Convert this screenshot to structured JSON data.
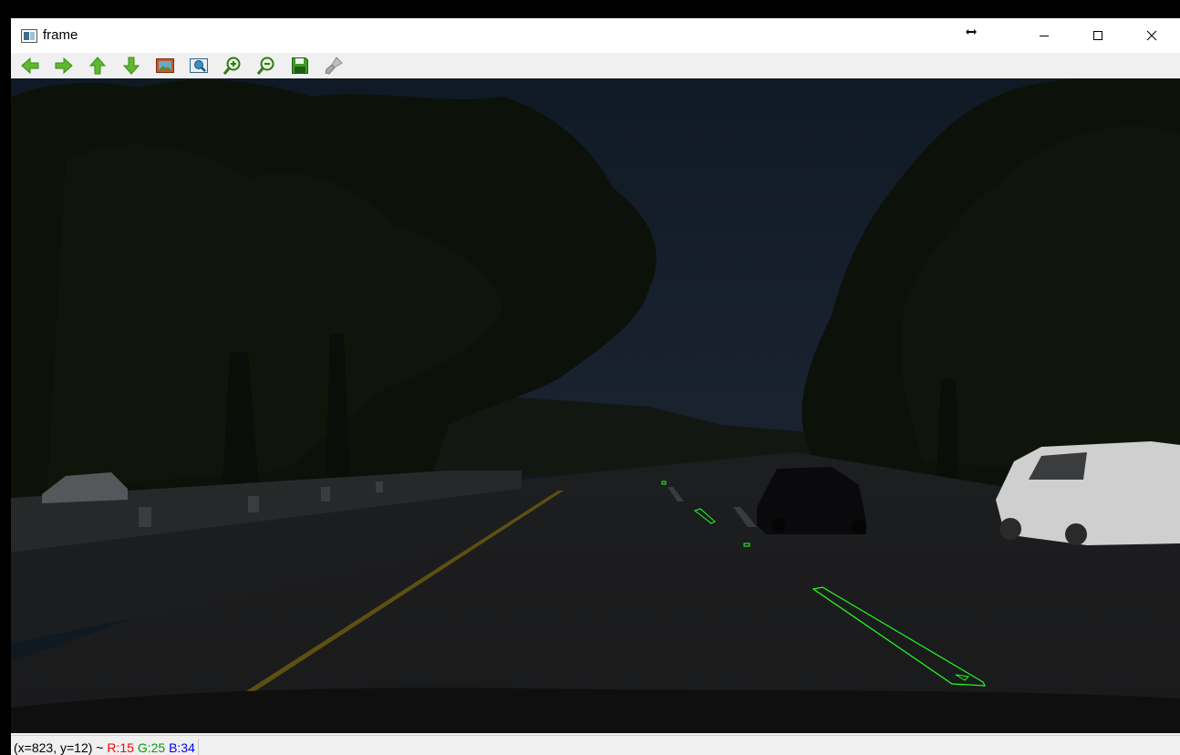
{
  "window": {
    "title": "frame",
    "controls": [
      "minimize",
      "maximize",
      "close"
    ]
  },
  "toolbar": {
    "buttons": [
      {
        "icon": "arrow-left-icon",
        "color": "#5fb82e"
      },
      {
        "icon": "arrow-right-icon",
        "color": "#5fb82e"
      },
      {
        "icon": "arrow-up-icon",
        "color": "#5fb82e"
      },
      {
        "icon": "arrow-down-icon",
        "color": "#5fb82e"
      },
      {
        "icon": "zoom-fit-icon",
        "color": "#d0602a"
      },
      {
        "icon": "zoom-original-icon",
        "color": "#2e8ad0"
      },
      {
        "icon": "zoom-in-icon",
        "color": "#5fb82e"
      },
      {
        "icon": "zoom-out-icon",
        "color": "#5fb82e"
      },
      {
        "icon": "save-icon",
        "color": "#2e7d1e"
      },
      {
        "icon": "properties-brush-icon",
        "color": "#999999"
      }
    ]
  },
  "image": {
    "description_colors": {
      "sky": "#141c2a",
      "trees": "#0d1309",
      "road": "#1b1c1d",
      "lane_yellow": "#6b5a12",
      "detected_outline": "#22ff22"
    }
  },
  "statusbar": {
    "coords": "(x=823, y=12) ~",
    "r": "R:15",
    "g": "G:25",
    "b": "B:34",
    "r_color": "#ff0000",
    "g_color": "#00a000",
    "b_color": "#0000ff"
  }
}
